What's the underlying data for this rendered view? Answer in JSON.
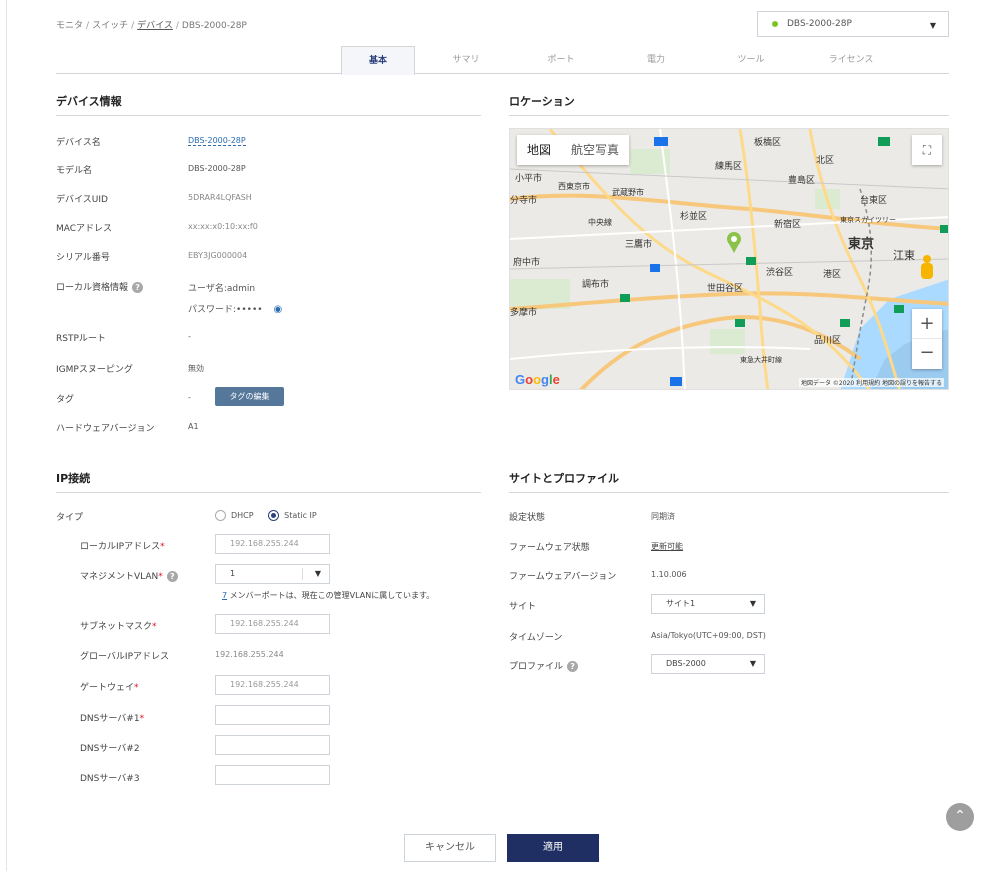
{
  "breadcrumb": {
    "items": [
      "モニタ",
      "スイッチ",
      "デバイス",
      "DBS-2000-28P"
    ]
  },
  "device_selector": {
    "value": "DBS-2000-28P",
    "status_color": "#7cc424"
  },
  "tabs": [
    {
      "label": "基本",
      "active": true
    },
    {
      "label": "サマリ"
    },
    {
      "label": "ポート"
    },
    {
      "label": "電力"
    },
    {
      "label": "ツール"
    },
    {
      "label": "ライセンス"
    }
  ],
  "device_info": {
    "title": "デバイス情報",
    "fields": {
      "name_label": "デバイス名",
      "name_value": "DBS-2000-28P",
      "model_label": "モデル名",
      "model_value": "DBS-2000-28P",
      "uid_label": "デバイスUID",
      "uid_value": "5DRAR4LQFASH",
      "mac_label": "MACアドレス",
      "mac_value": "xx:xx:x0:10:xx:f0",
      "serial_label": "シリアル番号",
      "serial_value": "EBY3JG000004",
      "cred_label": "ローカル資格情報",
      "cred_user": "ユーザ名:admin",
      "cred_pass": "パスワード:•••••",
      "rstp_label": "RSTPルート",
      "rstp_value": "-",
      "igmp_label": "IGMPスヌーピング",
      "igmp_value": "無効",
      "tag_label": "タグ",
      "tag_value": "-",
      "tag_button": "タグの編集",
      "hw_label": "ハードウェアバージョン",
      "hw_value": "A1"
    }
  },
  "location": {
    "title": "ロケーション",
    "map": {
      "toggle_map": "地図",
      "toggle_sat": "航空写真",
      "footer": "地図データ ©2020  利用規約  地図の誤りを報告する",
      "google": "Google",
      "zoom_in": "+",
      "zoom_out": "−",
      "places": [
        "板橋区",
        "北区",
        "練馬区",
        "豊島区",
        "台東区",
        "小平市",
        "西東京市",
        "武蔵野市",
        "分寺市",
        "中央線",
        "杉並区",
        "新宿区",
        "東京",
        "三鷹市",
        "府中市",
        "渋谷区",
        "港区",
        "江東",
        "調布市",
        "世田谷区",
        "多摩市",
        "品川区",
        "東急大井町線",
        "東京スカイツリー"
      ]
    }
  },
  "ip": {
    "title": "IP接続",
    "type_label": "タイプ",
    "type_dhcp": "DHCP",
    "type_static": "Static IP",
    "local_ip_label": "ローカルIPアドレス",
    "local_ip_value": "192.168.255.244",
    "vlan_label": "マネジメントVLAN",
    "vlan_value": "1",
    "vlan_note_count": "7",
    "vlan_note": " メンバーポートは、現在この管理VLANに属しています。",
    "subnet_label": "サブネットマスク",
    "subnet_value": "192.168.255.244",
    "global_ip_label": "グローバルIPアドレス",
    "global_ip_value": "192.168.255.244",
    "gateway_label": "ゲートウェイ",
    "gateway_value": "192.168.255.244",
    "dns1_label": "DNSサーバ#1",
    "dns2_label": "DNSサーバ#2",
    "dns3_label": "DNSサーバ#3",
    "dns1_value": "",
    "dns2_value": "",
    "dns3_value": ""
  },
  "site_profile": {
    "title": "サイトとプロファイル",
    "config_label": "設定状態",
    "config_value": "同期済",
    "fw_status_label": "ファームウェア状態",
    "fw_status_value": "更新可能",
    "fw_ver_label": "ファームウェアバージョン",
    "fw_ver_value": "1.10.006",
    "site_label": "サイト",
    "site_value": "サイト1",
    "tz_label": "タイムゾーン",
    "tz_value": "Asia/Tokyo(UTC+09:00, DST)",
    "profile_label": "プロファイル",
    "profile_value": "DBS-2000"
  },
  "actions": {
    "cancel": "キャンセル",
    "apply": "適用"
  }
}
